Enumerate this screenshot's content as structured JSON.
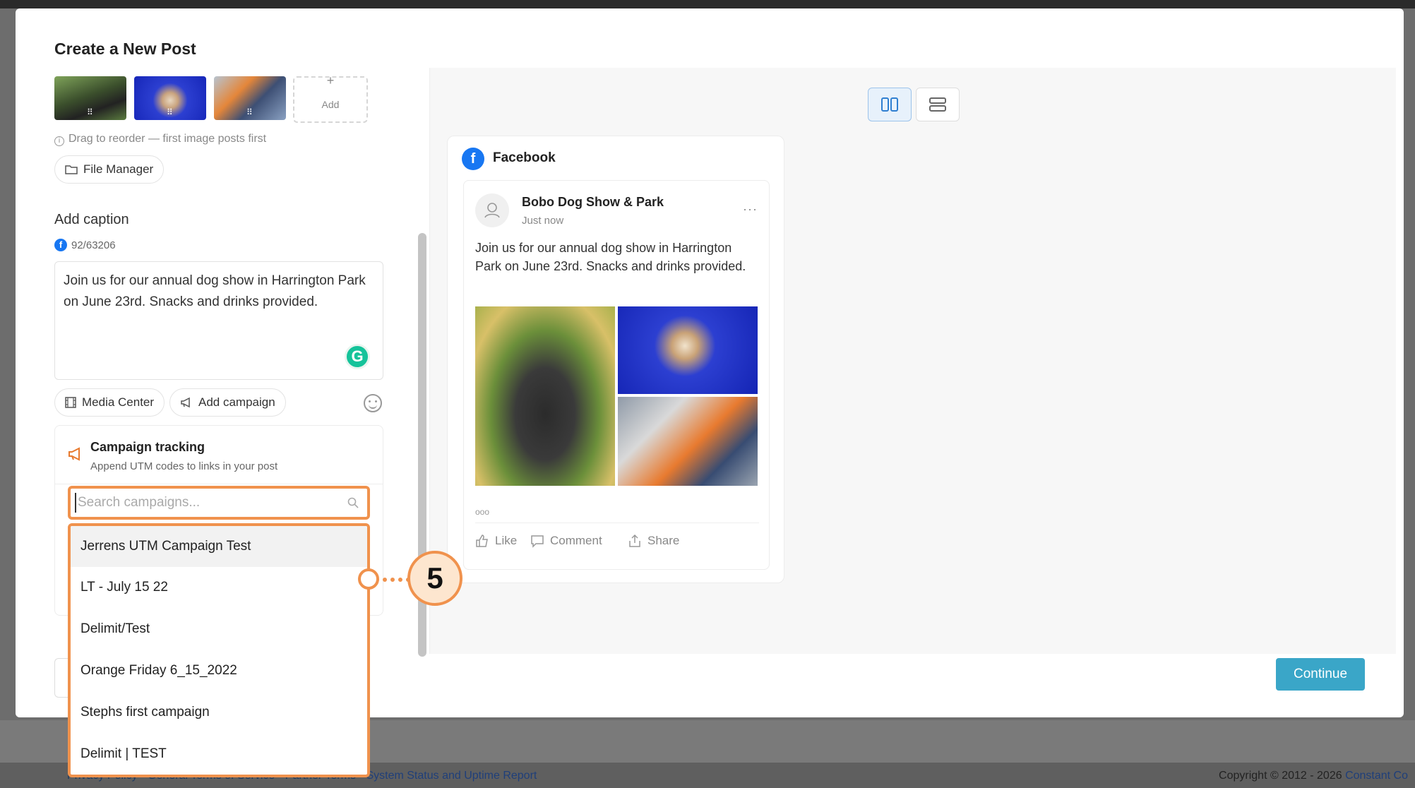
{
  "modal": {
    "title": "Create a New Post"
  },
  "left_panel": {
    "add_tile_label": "Add",
    "add_tile_plus": "+",
    "drag_hint": "Drag to reorder — first image posts first",
    "file_manager_label": "File Manager",
    "caption_label": "Add caption",
    "char_count": "92/63206",
    "caption_text": "Join us for our annual dog show in Harrington Park on June 23rd. Snacks and drinks provided.",
    "grammarly_letter": "G",
    "media_center_label": "Media Center",
    "add_campaign_label": "Add campaign",
    "campaign_tracking": {
      "title": "Campaign tracking",
      "subtitle": "Append UTM codes to links in your post"
    }
  },
  "campaign_dropdown": {
    "search_placeholder": "Search campaigns...",
    "search_value": "",
    "items": [
      "Jerrens UTM Campaign Test",
      "LT - July 15 22",
      "Delimit/Test",
      "Orange Friday 6_15_2022",
      "Stephs first campaign",
      "Delimit | TEST"
    ],
    "hovered_index": 0
  },
  "preview": {
    "network_label": "Facebook",
    "network_icon_letter": "f",
    "post": {
      "author": "Bobo Dog Show & Park",
      "time": "Just now",
      "more": "···",
      "text": "Join us for our annual dog show in Harrington Park on June 23rd. Snacks and drinks provided.",
      "reactions": "ooo",
      "actions": {
        "like": "Like",
        "comment": "Comment",
        "share": "Share"
      }
    }
  },
  "footer": {
    "continue_label": "Continue",
    "links_left": "Privacy Policy • General Terms of Service • Partner Terms •",
    "links_status": "System Status and Uptime Report",
    "copyright": "Copyright © 2012 - 2026",
    "brand": "Constant Co"
  },
  "annotation": {
    "step_number": "5"
  },
  "colors": {
    "accent_orange": "#f0924d",
    "continue_teal": "#3aa6c8",
    "facebook_blue": "#1877f2"
  }
}
